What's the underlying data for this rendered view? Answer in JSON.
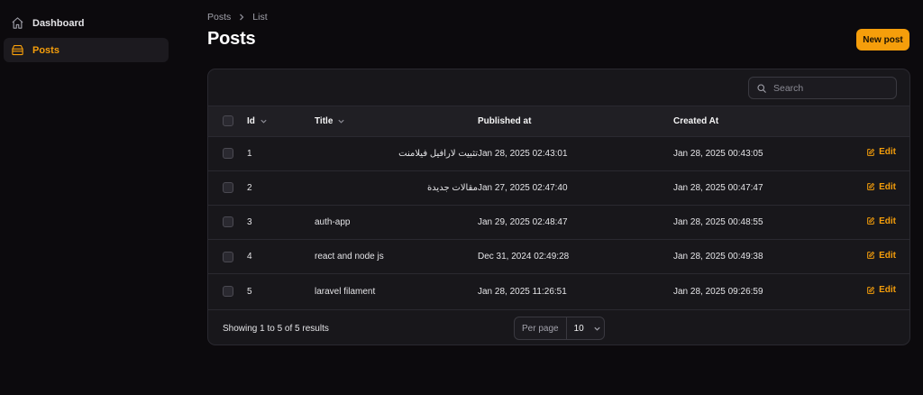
{
  "sidebar": {
    "items": [
      {
        "label": "Dashboard",
        "icon": "home-icon",
        "active": false
      },
      {
        "label": "Posts",
        "icon": "archive-icon",
        "active": true
      }
    ]
  },
  "breadcrumb": {
    "items": [
      "Posts",
      "List"
    ]
  },
  "page": {
    "title": "Posts",
    "new_button": "New post"
  },
  "search": {
    "placeholder": "Search"
  },
  "table": {
    "columns": {
      "id": "Id",
      "title": "Title",
      "published": "Published at",
      "created": "Created At"
    },
    "edit_label": "Edit",
    "rows": [
      {
        "id": "1",
        "title": "تثبيت لارافيل فيلامنت",
        "published": "Jan 28, 2025 02:43:01",
        "created": "Jan 28, 2025 00:43:05"
      },
      {
        "id": "2",
        "title": "مقالات جديدة",
        "published": "Jan 27, 2025 02:47:40",
        "created": "Jan 28, 2025 00:47:47"
      },
      {
        "id": "3",
        "title": "auth-app",
        "published": "Jan 29, 2025 02:48:47",
        "created": "Jan 28, 2025 00:48:55"
      },
      {
        "id": "4",
        "title": "react and node js",
        "published": "Dec 31, 2024 02:49:28",
        "created": "Jan 28, 2025 00:49:38"
      },
      {
        "id": "5",
        "title": "laravel filament",
        "published": "Jan 28, 2025 11:26:51",
        "created": "Jan 28, 2025 09:26:59"
      }
    ]
  },
  "footer": {
    "results": "Showing 1 to 5 of 5 results",
    "per_page_label": "Per page",
    "per_page_value": "10"
  },
  "colors": {
    "accent": "#f59e0b",
    "background": "#0c0a0d",
    "card": "#18171b"
  }
}
